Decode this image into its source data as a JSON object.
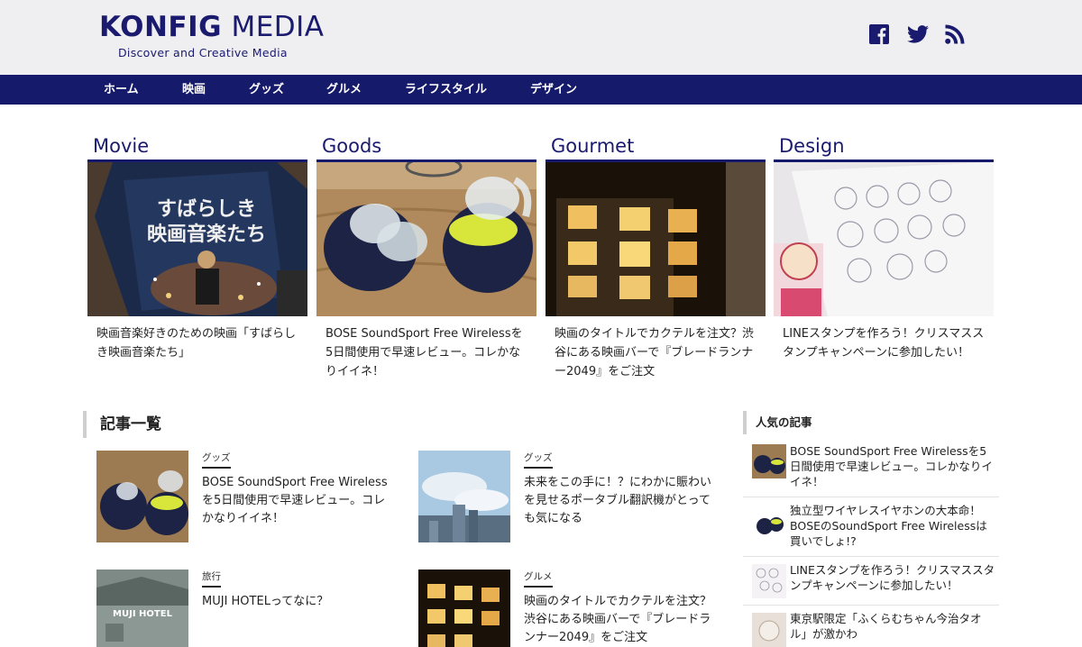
{
  "header": {
    "logo_bold": "KONFIG",
    "logo_rest": "MEDIA",
    "tagline": "Discover and Creative Media",
    "social": [
      {
        "name": "facebook-icon"
      },
      {
        "name": "twitter-icon"
      },
      {
        "name": "rss-icon"
      }
    ]
  },
  "nav": {
    "items": [
      "ホーム",
      "映画",
      "グッズ",
      "グルメ",
      "ライフスタイル",
      "デザイン"
    ]
  },
  "featured": [
    {
      "heading": "Movie",
      "title": "映画音楽好きのための映画「すばらしき映画音楽たち」",
      "poster_line1": "すばらしき",
      "poster_line2": "映画音楽たち"
    },
    {
      "heading": "Goods",
      "title": "BOSE SoundSport Free Wirelessを5日間使用で早速レビュー。コレかなりイイネ！"
    },
    {
      "heading": "Gourmet",
      "title": "映画のタイトルでカクテルを注文？渋谷にある映画バーで『ブレードランナー2049』をご注文"
    },
    {
      "heading": "Design",
      "title": "LINEスタンプを作ろう！クリスマススタンプキャンペーンに参加したい！"
    }
  ],
  "articles_section": {
    "title": "記事一覧",
    "items": [
      {
        "category": "グッズ",
        "title": "BOSE SoundSport Free Wirelessを5日間使用で早速レビュー。コレかなりイイネ！"
      },
      {
        "category": "グッズ",
        "title": "未来をこの手に！？にわかに賑わいを見せるポータブル翻訳機がとっても気になる"
      },
      {
        "category": "旅行",
        "title": "MUJI HOTELってなに？",
        "thumb_text": "MUJI HOTEL"
      },
      {
        "category": "グルメ",
        "title": "映画のタイトルでカクテルを注文？渋谷にある映画バーで『ブレードランナー2049』をご注文"
      }
    ]
  },
  "popular": {
    "title": "人気の記事",
    "items": [
      {
        "title": "BOSE SoundSport Free Wirelessを5日間使用で早速レビュー。コレかなりイイネ！"
      },
      {
        "title": "独立型ワイヤレスイヤホンの大本命！BOSEのSoundSport Free Wirelessは買いでしょ!?"
      },
      {
        "title": "LINEスタンプを作ろう！クリスマススタンプキャンペーンに参加したい！"
      },
      {
        "title": "東京駅限定「ふくらむちゃん今治タオル」が激かわ"
      }
    ]
  },
  "colors": {
    "nav_bg": "#151a6a",
    "brand": "#1a1a6e",
    "header_bg": "#efeff1"
  }
}
